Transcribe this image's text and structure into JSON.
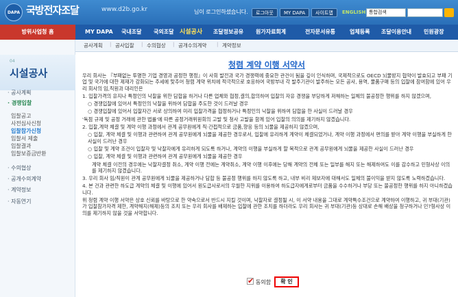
{
  "header": {
    "logo_mark": "DAPA",
    "logo_title": "국방전자조달",
    "logo_url": "www.d2b.go.kr",
    "login_message": "님이 로그인하셨습니다.",
    "buttons": [
      "로그아웃",
      "MY DAPA",
      "사이트맵",
      "ENGLISH"
    ],
    "search_select": "통합검색"
  },
  "mainnav": {
    "home": "방위사업청 홈",
    "items": [
      "MY DAPA",
      "국내조달",
      "국외조달",
      "시설공사",
      "조달정보공유",
      "원가자료회계",
      "전자문서유통",
      "업체등록",
      "조달이용안내",
      "민원광장"
    ],
    "active_index": 3
  },
  "subnav": {
    "items": [
      "공사계획",
      "공사입찰",
      "수의협상",
      "공개수의계약",
      "계약정보"
    ]
  },
  "sidebar": {
    "small_label": "04",
    "title": "시설공사",
    "items": [
      {
        "label": "· 공사계획",
        "style": "normal"
      },
      {
        "label": "· 경쟁입찰",
        "style": "green"
      },
      {
        "label": "입찰공고",
        "style": "sub"
      },
      {
        "label": "사전심사신청",
        "style": "sub"
      },
      {
        "label": "입찰참가신청",
        "style": "active"
      },
      {
        "label": "입찰서 제출",
        "style": "sub"
      },
      {
        "label": "입찰결과",
        "style": "sub"
      },
      {
        "label": "입찰보증금반환",
        "style": "sub"
      },
      {
        "label": "· 수의협상",
        "style": "normal"
      },
      {
        "label": "· 공개수의계약",
        "style": "normal"
      },
      {
        "label": "· 계약정보",
        "style": "normal"
      },
      {
        "label": "· 자동연기",
        "style": "normal"
      }
    ]
  },
  "document": {
    "title": "청렴 계약 이행 서약서",
    "paragraphs": [
      {
        "cls": "",
        "text": "우리 회사는 『부패없는 투명한 기업 경영과 공정한 행정』이 사회 발전과 국가 경쟁력에 중요한 관건이 됨을 깊이 인식하며, 국제적으로도 OECD 뇌물방지 협약이 발효되고 부패 기업 및 국가에 대한 제재가 강화되는 추세에 맞추어 청렴 계약 위치에 적극적으로 호응하여 국방부내 각 발주기관이 발주하는 모든 공사, 용역, 물품구매 등의 입찰에 참여함에 있어 우리 회사의 임,직원과 대리인은"
      },
      {
        "cls": "",
        "text": "1. 입찰가격의 유지나 특정인의 낙찰을 위한 담합을 하거나 다른 업체와 협정,결의,합의하여 입찰의 자유 경쟁을 부당하게 저해하는 일체의 불공정한 행위를 하지 않겠으며,"
      },
      {
        "cls": "ind",
        "text": "○ 경쟁입찰에 있어서 특정인의 낙찰을 위하여 담합을 주도한 것이 드러날 경우"
      },
      {
        "cls": "ind",
        "text": "○ 경쟁입찰에 있어서 입찰자간 서로 상의하여 미리 입찰가격을 협정하거나 특정인의 낙찰을 위하여 담합을 한 사실이 드러날 경우"
      },
      {
        "cls": "",
        "text": "'독점 규제 및 공정 거래에 관한 법률'에 따른 공정거래위원회의 고발 및 청사 고발을 함께 있어 입찰의 의의를 제기하지 않겠습니다."
      },
      {
        "cls": "",
        "text": "2. 입찰,계약 체결 및 계약 이행 과정에서 관계 공무원에게 직·간접적으로 금품,향응 등의 뇌물을 제공하지 않겠으며,"
      },
      {
        "cls": "ind",
        "text": "○ 입찰, 계약 체결 및 이행과 관련하여 관계 공무원에게 뇌물을 제공한 경우로서, 입찰에 유리하게 계약이 체결되었거나, 계약 이행 과정에서 편의를 받아 계약 이행을 부실하게 한 사실이 드러난 경우"
      },
      {
        "cls": "ind",
        "text": "○ 입찰 및 계약 조건이 입찰자 및 낙찰자에게 유리하게 되도록 하거나, 계약의 이행을 부실하게 할 목적으로 관계 공무원에게 뇌물을 제공한 사실이 드러난 경우"
      },
      {
        "cls": "ind",
        "text": "○ 입찰, 계약 체결 및 이행과 관련하여 관계 공무원에게 뇌물을 제공한 경우"
      },
      {
        "cls": "ind2",
        "text": "계약 체결 이전의 경우에는 낙찰자결정 취소, 계약 이행 전에는 계약취소, 계약 이행 이후에는 당해 계약의 전체 또는 일부를 해지 또는 해제하여도 이를 감수하고 민형사상 이의를 제기하지 않겠습니다."
      },
      {
        "cls": "",
        "text": "3. 우리 회사 임/직원이 관계 공무원에게 뇌물을 제공하거나 담합 등 불공정 행위를 하지 않도록 하고, 내부 비리 제보자에 대해서도 일체의 불이익을 받지 않도록 노력하겠습니다."
      },
      {
        "cls": "",
        "text": "4. 본 건과 관련한 하도급 계약의 체결 및 이행에 있어서 원도급사로서의 우월한 지위를 이용하여 하도급자에게로부터 금품을 수수하거나 부당 또는 불공정한 행위를 하지 아니하겠습니다."
      },
      {
        "cls": "",
        "text": "위 청렴 계약 이행 서약은 상호 신뢰를 바탕으로 한 약속으로서 반드시 지킬 것이며, 낙찰자로 결정될 시, 이 서약 내용을 그대로 계약특수조건으로 계약하여 이행하고, 귀 부대(기관)가 입찰참가자격 제한, 계약해지(해제)등의 조치 또는 우리 회사를 배제하는 입찰에 관한 조치를 하더라도 우리 회사는 귀 부대(기관)등 상대로 손해 배상을 청구하거나 민?형사상 이의를 제기하지 않을 것을 서약합니다."
      }
    ]
  },
  "agree": {
    "checkmark": "✔",
    "label": "동의함"
  },
  "confirm_button": "확 인"
}
